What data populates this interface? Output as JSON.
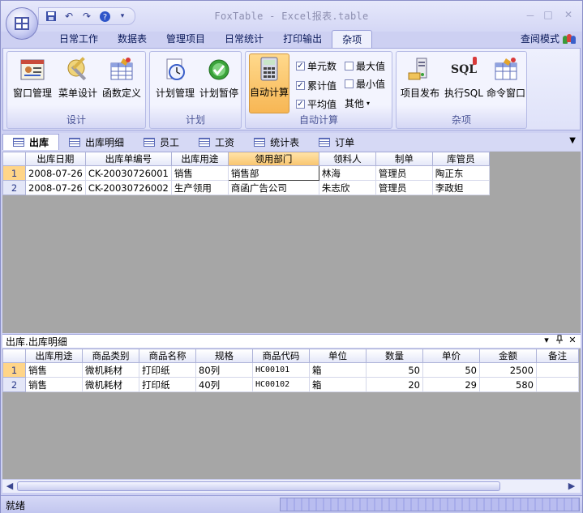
{
  "window": {
    "title": "FoxTable - Excel报表.table",
    "min": "－",
    "max": "□",
    "close": "✕"
  },
  "menu": {
    "tabs": [
      "日常工作",
      "数据表",
      "管理项目",
      "日常统计",
      "打印输出",
      "杂项"
    ],
    "active": "杂项",
    "view_mode": "查阅模式"
  },
  "ribbon": {
    "design": {
      "label": "设计",
      "buttons": [
        "窗口管理",
        "菜单设计",
        "函数定义"
      ]
    },
    "plan": {
      "label": "计划",
      "buttons": [
        "计划管理",
        "计划暂停"
      ]
    },
    "autocalc": {
      "label": "自动计算",
      "button": "自动计算",
      "checks": [
        {
          "label": "单元数",
          "checked": true
        },
        {
          "label": "最大值",
          "checked": false
        },
        {
          "label": "累计值",
          "checked": true
        },
        {
          "label": "最小值",
          "checked": false
        },
        {
          "label": "平均值",
          "checked": true
        }
      ],
      "other": "其他"
    },
    "misc": {
      "label": "杂项",
      "buttons": [
        "项目发布",
        "执行SQL",
        "命令窗口"
      ],
      "sql_text": "SQL"
    }
  },
  "sheet_tabs": [
    "出库",
    "出库明细",
    "员工",
    "工资",
    "统计表",
    "订单"
  ],
  "table1": {
    "headers": [
      "出库日期",
      "出库单编号",
      "出库用途",
      "领用部门",
      "领料人",
      "制单",
      "库管员"
    ],
    "rows": [
      [
        "1",
        "2008-07-26",
        "CK-20030726001",
        "销售",
        "销售部",
        "林海",
        "管理员",
        "陶正东"
      ],
      [
        "2",
        "2008-07-26",
        "CK-20030726002",
        "生产领用",
        "商函广告公司",
        "朱志欣",
        "管理员",
        "李政妲"
      ]
    ]
  },
  "subpanel": {
    "title": "出库.出库明细",
    "pin": "ᵖ",
    "close": "✕",
    "dropdown": "▾"
  },
  "table2": {
    "headers": [
      "出库用途",
      "商品类别",
      "商品名称",
      "规格",
      "商品代码",
      "单位",
      "数量",
      "单价",
      "金额",
      "备注"
    ],
    "rows": [
      [
        "1",
        "销售",
        "微机耗材",
        "打印纸",
        "80列",
        "HC00101",
        "箱",
        "50",
        "50",
        "2500",
        ""
      ],
      [
        "2",
        "销售",
        "微机耗材",
        "打印纸",
        "40列",
        "HC00102",
        "箱",
        "20",
        "29",
        "580",
        ""
      ]
    ]
  },
  "status": {
    "text": "就绪"
  }
}
